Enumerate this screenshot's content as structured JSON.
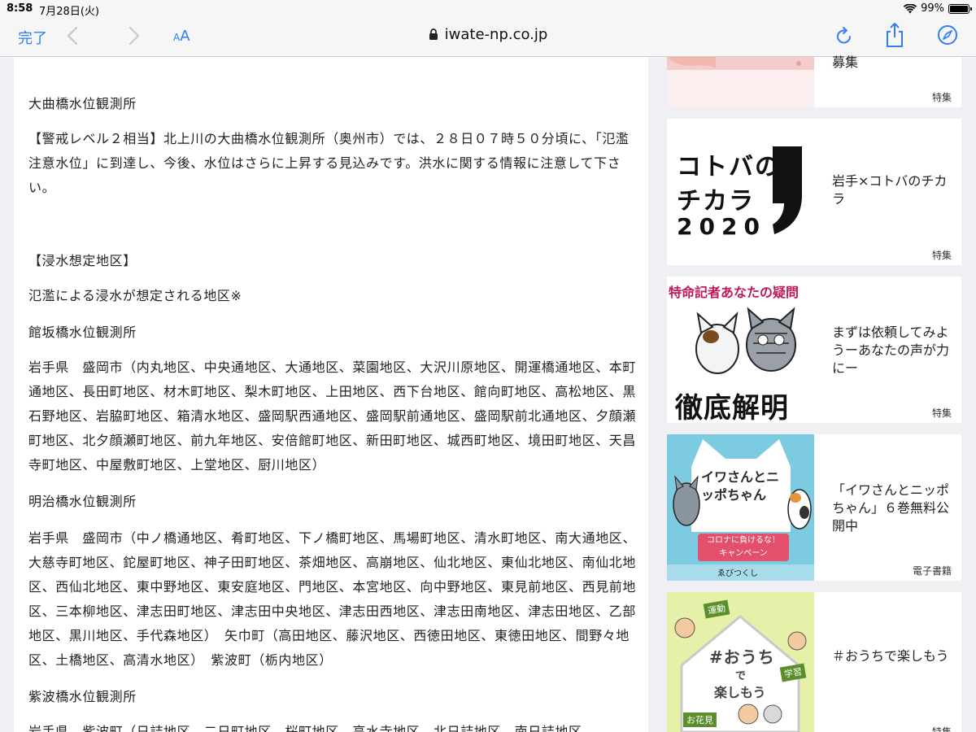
{
  "status_bar": {
    "time": "8:58",
    "date": "7月28日(火)",
    "battery": "99%",
    "wifi_icon": "wifi-icon",
    "battery_icon": "battery-icon"
  },
  "toolbar": {
    "done_label": "完了",
    "text_size_small": "A",
    "text_size_large": "A",
    "url": "iwate-np.co.jp",
    "icons": [
      "back-chevron-icon",
      "forward-chevron-icon",
      "lock-icon",
      "reload-icon",
      "share-icon",
      "compass-icon"
    ],
    "accent_color": "#2f7ef6"
  },
  "article": {
    "p1": "大曲橋水位観測所",
    "p2": "【警戒レベル２相当】北上川の大曲橋水位観測所（奥州市）では、２８日０７時５０分頃に、「氾濫注意水位」に到達し、今後、水位はさらに上昇する見込みです。洪水に関する情報に注意して下さい。",
    "p3": "【浸水想定地区】",
    "p4": "氾濫による浸水が想定される地区※",
    "p5": "館坂橋水位観測所",
    "p6": "岩手県　盛岡市（内丸地区、中央通地区、大通地区、菜園地区、大沢川原地区、開運橋通地区、本町通地区、長田町地区、材木町地区、梨木町地区、上田地区、西下台地区、館向町地区、高松地区、黒石野地区、岩脇町地区、箱清水地区、盛岡駅西通地区、盛岡駅前通地区、盛岡駅前北通地区、夕顔瀬町地区、北夕顔瀬町地区、前九年地区、安倍館町地区、新田町地区、城西町地区、境田町地区、天昌寺町地区、中屋敷町地区、上堂地区、厨川地区）",
    "p7": "明治橋水位観測所",
    "p8": "岩手県　盛岡市（中ノ橋通地区、肴町地区、下ノ橋町地区、馬場町地区、清水町地区、南大通地区、大慈寺町地区、鉈屋町地区、神子田町地区、茶畑地区、高崩地区、仙北地区、東仙北地区、南仙北地区、西仙北地区、東中野地区、東安庭地区、門地区、本宮地区、向中野地区、東見前地区、西見前地区、三本柳地区、津志田町地区、津志田中央地区、津志田西地区、津志田南地区、津志田地区、乙部地区、黒川地区、手代森地区）　矢巾町（高田地区、藤沢地区、西徳田地区、東徳田地区、間野々地区、土橋地区、高清水地区）　紫波町（栃内地区）",
    "p9": "紫波橋水位観測所",
    "p10": "岩手県　紫波町（日詰地区、二日町地区、桜町地区、高水寺地区、北日詰地区、南日詰地区"
  },
  "sidebar": {
    "cards": [
      {
        "title": "募集",
        "tag": "特集"
      },
      {
        "title": "岩手×コトバのチカラ",
        "tag": "特集",
        "thumb_lines": [
          "コトバの",
          "チカラ",
          "2020"
        ]
      },
      {
        "title": "まずは依頼してみようーあなたの声が力にー",
        "tag": "特集",
        "thumb_top": "特命記者あなたの疑問",
        "thumb_bottom": "徹底解明"
      },
      {
        "title": "「イワさんとニッポちゃん」６巻無料公開中",
        "tag": "電子書籍",
        "thumb_title": "イワさんとニッポちゃん",
        "thumb_banner_1": "コロナに負けるな！",
        "thumb_banner_2": "キャンペーン",
        "thumb_credit": "ゑびつくし"
      },
      {
        "title": "＃おうちで楽しもう",
        "tag": "特集",
        "thumb_main_1": "#おうち",
        "thumb_main_2": "で",
        "thumb_main_3": "楽しもう",
        "thumb_sign_1": "運動",
        "thumb_sign_2": "学習",
        "thumb_sign_3": "お花見"
      }
    ]
  }
}
